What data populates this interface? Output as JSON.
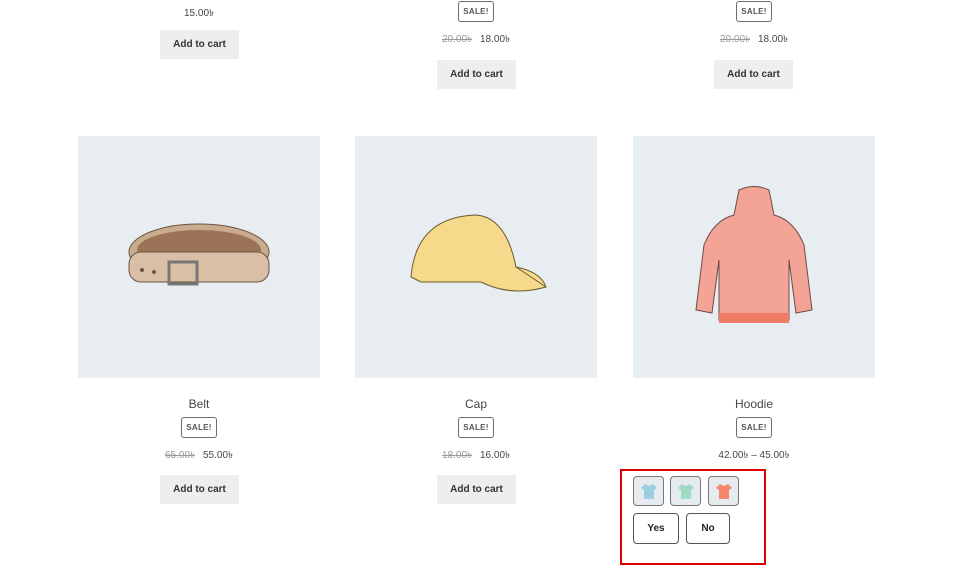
{
  "top_row": [
    {
      "price": "15.00৳",
      "button": "Add to cart"
    },
    {
      "badge": "SALE!",
      "old_price": "20.00৳",
      "price": "18.00৳",
      "button": "Add to cart"
    },
    {
      "badge": "SALE!",
      "old_price": "20.00৳",
      "price": "18.00৳",
      "button": "Add to cart"
    }
  ],
  "products": [
    {
      "name": "Belt",
      "badge": "SALE!",
      "old_price": "65.00৳",
      "price": "55.00৳",
      "button": "Add to cart",
      "image": "belt"
    },
    {
      "name": "Cap",
      "badge": "SALE!",
      "old_price": "18.00৳",
      "price": "16.00৳",
      "button": "Add to cart",
      "image": "cap"
    },
    {
      "name": "Hoodie",
      "badge": "SALE!",
      "price": "42.00৳ – 45.00৳",
      "image": "hoodie"
    }
  ],
  "variations": {
    "swatches": [
      {
        "color": "#9ccfe0",
        "name": "blue"
      },
      {
        "color": "#9fdcc4",
        "name": "green"
      },
      {
        "color": "#f3876a",
        "name": "orange"
      }
    ],
    "options": [
      "Yes",
      "No"
    ],
    "highlight_color": "#e00000"
  }
}
